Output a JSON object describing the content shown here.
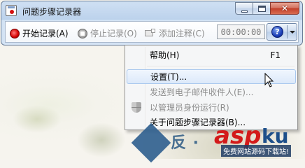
{
  "window": {
    "title": "问题步骤记录器"
  },
  "toolbar": {
    "start_record_label": "开始记录(A)",
    "stop_record_label": "停止记录(O)",
    "add_comment_label": "添加注释(C)",
    "timer_value": "00:00:00"
  },
  "menu": {
    "items": [
      {
        "label": "帮助(H)",
        "shortcut": "F1",
        "disabled": false
      },
      {
        "label": "设置(T)...",
        "disabled": false,
        "hovered": true
      },
      {
        "label": "发送到电子邮件收件人(E)...",
        "disabled": true
      },
      {
        "label": "以管理员身份运行(R)",
        "disabled": true,
        "icon": "shield-icon"
      },
      {
        "label": "关于问题步骤记录器(B)...",
        "disabled": false
      }
    ]
  },
  "watermark": {
    "text_left": "反 ·",
    "text_brand_red": "asp",
    "text_brand_blue": "ku",
    "tagline": "免费网站源码下载站!"
  },
  "colors": {
    "record_red": "#d40000",
    "help_blue": "#1d3fb8",
    "menu_hover": "#dce9fa",
    "watermark_red": "#d31a1a",
    "watermark_blue": "#1d4f8a"
  }
}
